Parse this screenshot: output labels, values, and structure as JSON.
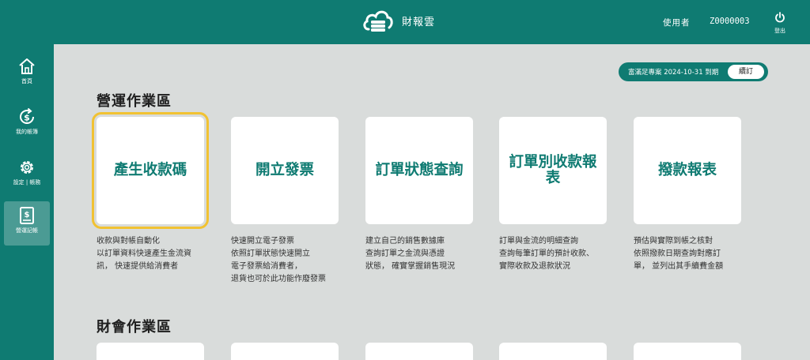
{
  "header": {
    "brand": "財報雲",
    "user_label": "使用者",
    "user_id": "Z0000003",
    "logout_label": "登出"
  },
  "sidebar": {
    "items": [
      {
        "label": "首頁",
        "icon": "home-icon"
      },
      {
        "label": "我的帳簿",
        "icon": "dollar-cycle-icon"
      },
      {
        "label": "設定 | 帳務",
        "icon": "gear-icon"
      },
      {
        "label": "營運記帳",
        "icon": "ledger-icon",
        "active": true
      }
    ]
  },
  "subscription": {
    "text": "富滿足專案 2024-10-31 到期",
    "renew_label": "續訂"
  },
  "sections": {
    "operations_title": "營運作業區",
    "finance_title": "財會作業區"
  },
  "cards": [
    {
      "title": "產生收款碼",
      "desc": [
        "收款與對帳自動化",
        "以訂單資料快速產生金流資",
        "訊， 快速提供給消費者"
      ],
      "selected": true
    },
    {
      "title": "開立發票",
      "desc": [
        "快速開立電子發票",
        "依照訂單狀態快速開立",
        "電子發票給消費者，",
        "退貨也可於此功能作廢發票"
      ]
    },
    {
      "title": "訂單狀態查詢",
      "desc": [
        "建立自己的銷售數據庫",
        "查詢訂單之金流與憑證",
        "狀態， 確實掌握銷售現況"
      ]
    },
    {
      "title": "訂單別收款報表",
      "desc": [
        "訂單與金流的明細查詢",
        "查詢每筆訂單的預計收款、",
        "實際收款及退款狀況"
      ]
    },
    {
      "title": "撥款報表",
      "desc": [
        "預估與實際到帳之核對",
        "依照撥款日期查詢對應訂",
        "單， 並列出其手續費金額"
      ]
    }
  ],
  "colors": {
    "primary": "#0f7b72",
    "background": "#d9dcdb",
    "highlight": "#f1c232",
    "sidebar_active": "#4b9b94"
  }
}
